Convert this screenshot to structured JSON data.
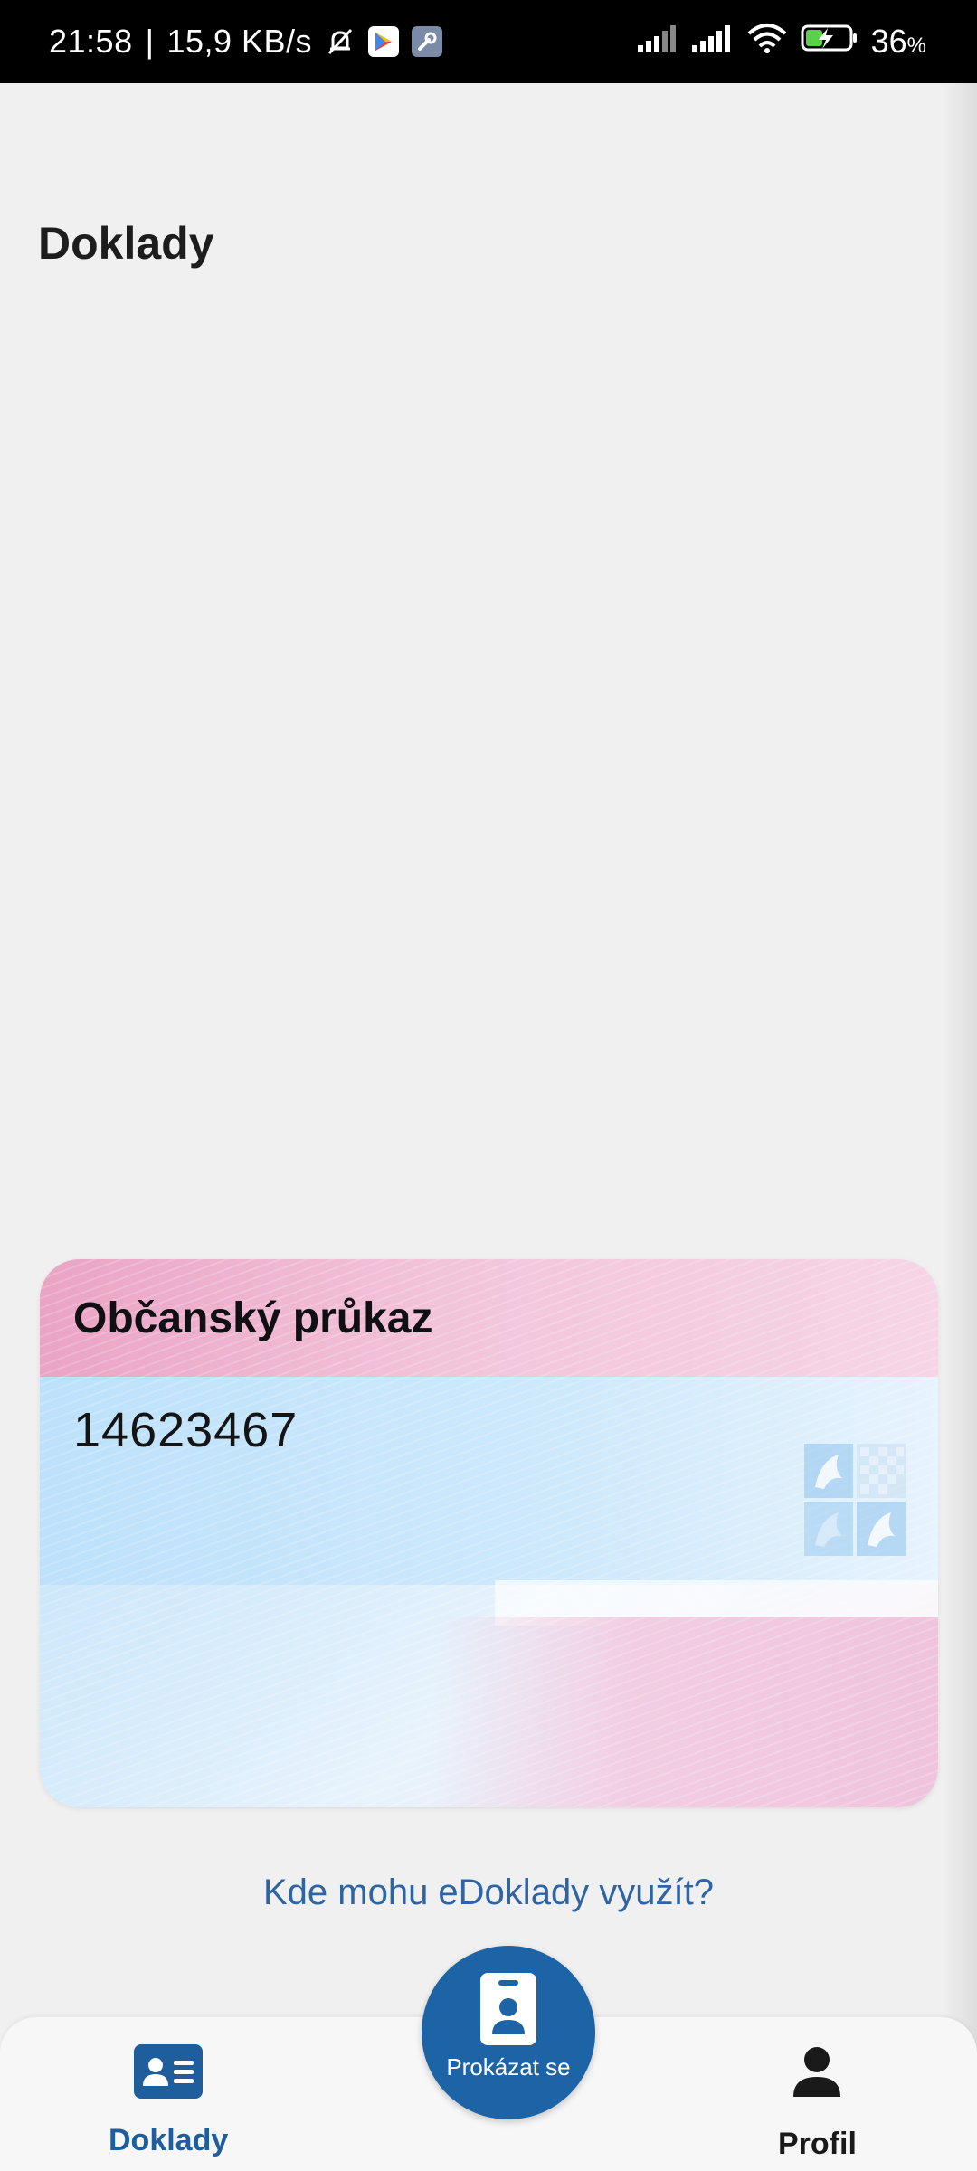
{
  "status_bar": {
    "time": "21:58",
    "network_speed": "15,9 KB/s",
    "separator": "|",
    "battery_percent": "36",
    "battery_unit": "%",
    "icons": [
      "muted-bell-icon",
      "play-store-icon",
      "wrench-icon",
      "signal-icon",
      "signal-icon",
      "wifi-icon",
      "battery-charging-icon"
    ]
  },
  "page": {
    "title": "Doklady"
  },
  "card": {
    "title": "Občanský průkaz",
    "number": "14623467"
  },
  "help_link": "Kde mohu eDoklady využít?",
  "bottom_nav": {
    "items": [
      {
        "label": "Doklady",
        "icon": "id-card-icon",
        "active": true
      },
      {
        "label": "Profil",
        "icon": "person-icon",
        "active": false
      }
    ],
    "fab": {
      "label": "Prokázat se",
      "icon": "badge-person-icon"
    }
  },
  "colors": {
    "accent": "#1d64a6",
    "link": "#2e64a3",
    "background": "#f0f0f0"
  }
}
